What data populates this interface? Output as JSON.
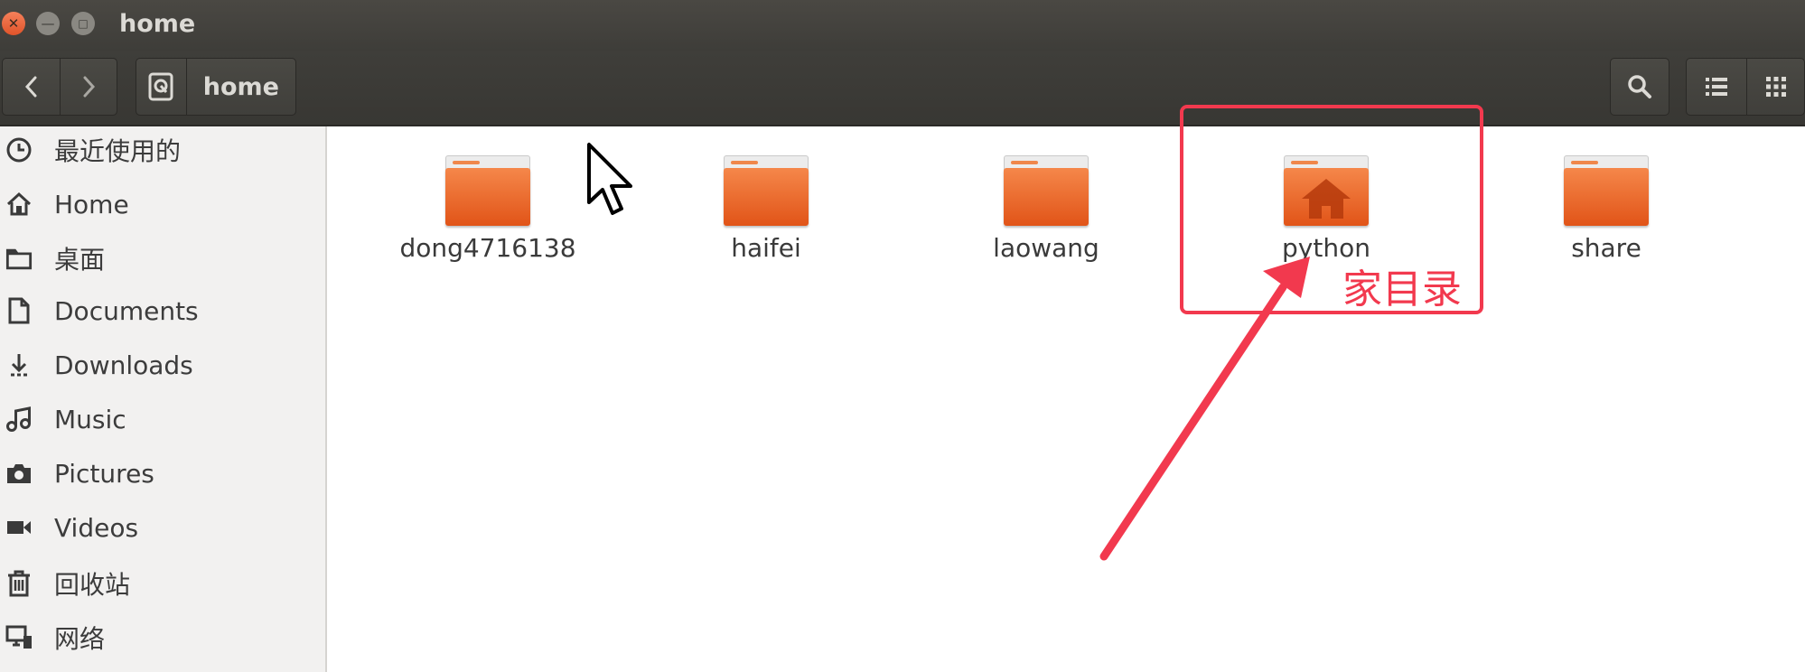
{
  "window": {
    "title": "home"
  },
  "toolbar": {
    "path_label": "home"
  },
  "sidebar": {
    "items": [
      {
        "label": "最近使用的",
        "icon": "clock-icon"
      },
      {
        "label": "Home",
        "icon": "home-icon"
      },
      {
        "label": "桌面",
        "icon": "folder-icon"
      },
      {
        "label": "Documents",
        "icon": "document-icon"
      },
      {
        "label": "Downloads",
        "icon": "download-icon"
      },
      {
        "label": "Music",
        "icon": "music-icon"
      },
      {
        "label": "Pictures",
        "icon": "camera-icon"
      },
      {
        "label": "Videos",
        "icon": "video-icon"
      },
      {
        "label": "回收站",
        "icon": "trash-icon"
      },
      {
        "label": "网络",
        "icon": "network-icon"
      }
    ]
  },
  "files": [
    {
      "name": "dong4716138",
      "icon": "folder-icon"
    },
    {
      "name": "haifei",
      "icon": "folder-icon"
    },
    {
      "name": "laowang",
      "icon": "folder-icon"
    },
    {
      "name": "python",
      "icon": "home-folder-icon"
    },
    {
      "name": "share",
      "icon": "folder-icon"
    }
  ],
  "annotation": {
    "note": "家目录",
    "color": "#f2394e"
  },
  "colors": {
    "titlebar": "#3e3d39",
    "folder_orange": "#e15418",
    "sidebar_bg": "#f2f1f0"
  }
}
